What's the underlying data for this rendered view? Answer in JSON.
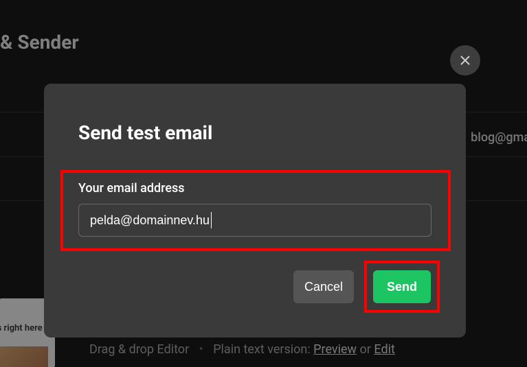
{
  "background": {
    "header": "& Sender",
    "email": "blog@gma",
    "thumb_text": "omes right here",
    "footer": {
      "editor": "Drag & drop Editor",
      "plain_label": "Plain text version:",
      "preview": "Preview",
      "or": "or",
      "edit": "Edit"
    }
  },
  "modal": {
    "title": "Send test email",
    "field_label": "Your email address",
    "email_value": "pelda@domainnev.hu",
    "cancel_label": "Cancel",
    "send_label": "Send"
  },
  "highlight_color": "#ff0000",
  "accent_color": "#1dc462"
}
